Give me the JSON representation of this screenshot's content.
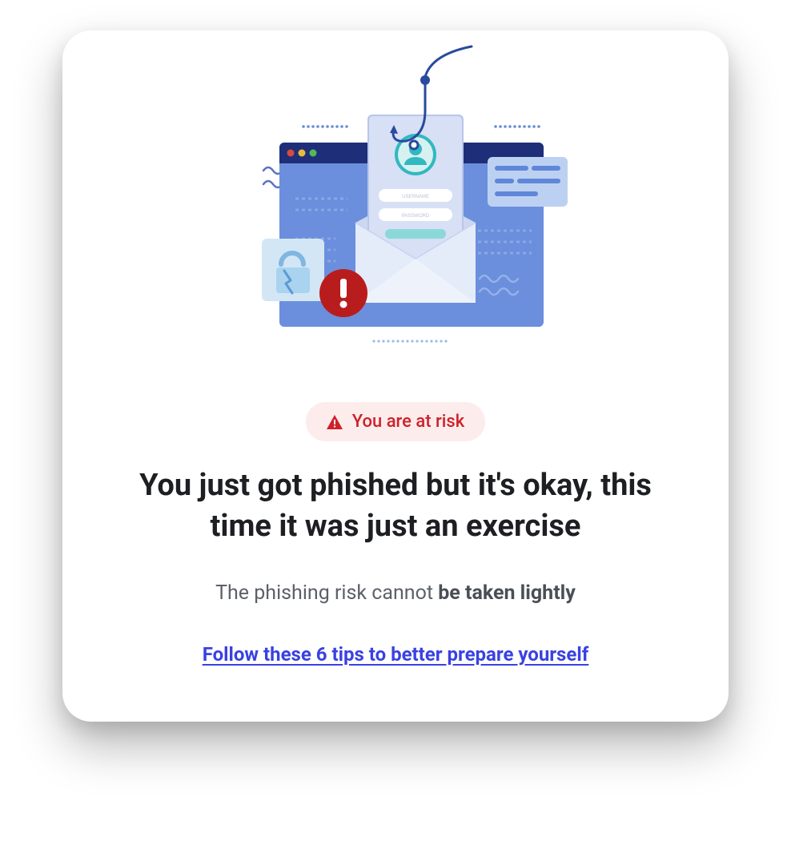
{
  "badge": {
    "label": "You are at risk"
  },
  "headline": "You just got phished but it's okay, this time it was just an exercise",
  "subtext": {
    "prefix": "The phishing risk cannot ",
    "bold": "be taken lightly"
  },
  "tips_link": "Follow these 6 tips to better prepare yourself",
  "illustration": {
    "form_labels": {
      "username": "USERNAME",
      "password": "PASSWORD"
    }
  },
  "colors": {
    "danger": "#cf2129",
    "danger_bg": "#fdecec",
    "link": "#3a41e1",
    "heading": "#1d1f23",
    "muted": "#5c6069"
  }
}
